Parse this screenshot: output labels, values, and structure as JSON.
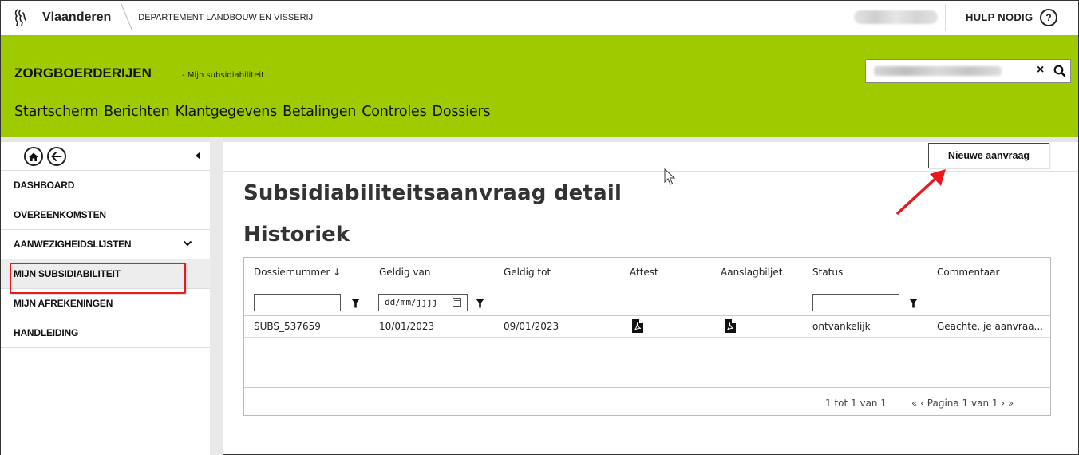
{
  "topbar": {
    "brand": "Vlaanderen",
    "department": "DEPARTEMENT LANDBOUW EN VISSERIJ",
    "help_label": "HULP NODIG",
    "help_icon": "?"
  },
  "header": {
    "app_title": "ZORGBOERDERIJEN",
    "app_subtitle": "- Mijn subsidiabiliteit",
    "search_clear": "×",
    "nav": [
      "Startscherm",
      "Berichten",
      "Klantgegevens",
      "Betalingen",
      "Controles",
      "Dossiers"
    ]
  },
  "sidebar": {
    "items": [
      {
        "label": "DASHBOARD"
      },
      {
        "label": "OVEREENKOMSTEN"
      },
      {
        "label": "AANWEZIGHEIDSLIJSTEN",
        "has_chevron": true
      },
      {
        "label": "MIJN SUBSIDIABILITEIT",
        "active": true
      },
      {
        "label": "MIJN AFREKENINGEN"
      },
      {
        "label": "HANDLEIDING"
      }
    ]
  },
  "main": {
    "new_button": "Nieuwe aanvraag",
    "title": "Subsidiabiliteitsaanvraag detail",
    "subtitle": "Historiek",
    "table": {
      "columns": [
        "Dossiernummer ↓",
        "Geldig van",
        "Geldig tot",
        "Attest",
        "Aanslagbiljet",
        "Status",
        "Commentaar"
      ],
      "date_placeholder": "dd/mm/jjjj",
      "rows": [
        {
          "dossiernummer": "SUBS_537659",
          "geldig_van": "10/01/2023",
          "geldig_tot": "09/01/2023",
          "attest": "pdf-icon",
          "aanslagbiljet": "pdf-icon",
          "status": "ontvankelijk",
          "commentaar": "Geachte, je aanvraa..."
        }
      ],
      "range_text": "1 tot 1 van 1",
      "pager_text": "« ‹ Pagina 1 van 1 › »"
    }
  },
  "colors": {
    "header_green": "#9fca00",
    "highlight_red": "#e8191c"
  }
}
